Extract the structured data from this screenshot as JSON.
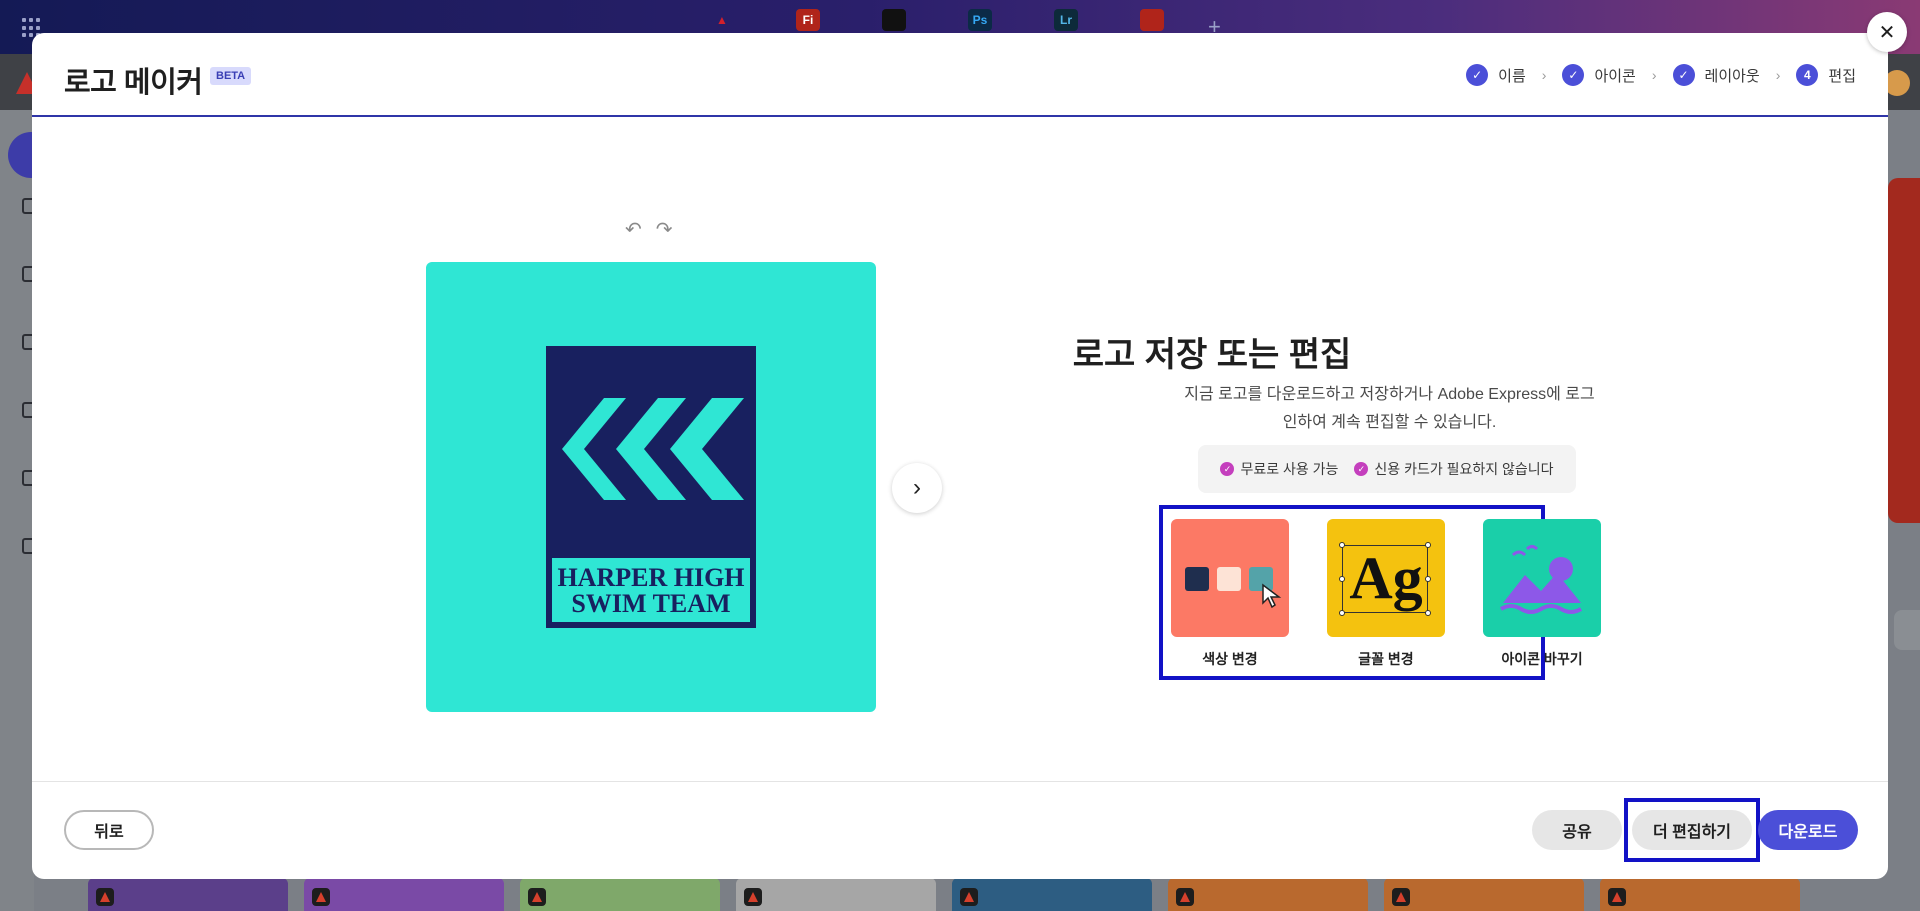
{
  "modal": {
    "title": "로고 메이커",
    "badge": "BETA",
    "steps": [
      {
        "label": "이름",
        "state": "done"
      },
      {
        "label": "아이콘",
        "state": "done"
      },
      {
        "label": "레이아웃",
        "state": "done"
      },
      {
        "label": "편집",
        "state": "current",
        "number": "4"
      }
    ],
    "close_icon": "close-icon"
  },
  "logo": {
    "text_line1": "HARPER HIGH",
    "text_line2": "SWIM TEAM",
    "background_color": "#2fe6d4",
    "mark_color": "#18205f"
  },
  "panel": {
    "heading": "로고 저장 또는 편집",
    "description": "지금 로고를 다운로드하고 저장하거나 Adobe Express에 로그인하여 계속 편집할 수 있습니다.",
    "benefits": [
      "무료로 사용 가능",
      "신용 카드가 필요하지 않습니다"
    ],
    "options": [
      {
        "label": "색상 변경",
        "tile_color": "#fc7965",
        "swatches": [
          "#1f2e4e",
          "#fde3d6",
          "#54a3a9"
        ]
      },
      {
        "label": "글꼴 변경",
        "tile_color": "#f4c20f",
        "sample": "Ag"
      },
      {
        "label": "아이콘 바꾸기",
        "tile_color": "#1acfa9",
        "icon_color": "#8d58e8"
      }
    ]
  },
  "footer": {
    "back_label": "뒤로",
    "share_label": "공유",
    "edit_more_label": "더 편집하기",
    "download_label": "다운로드"
  },
  "colors": {
    "accent": "#4b4fd8",
    "highlight_outline": "#1212c6"
  }
}
